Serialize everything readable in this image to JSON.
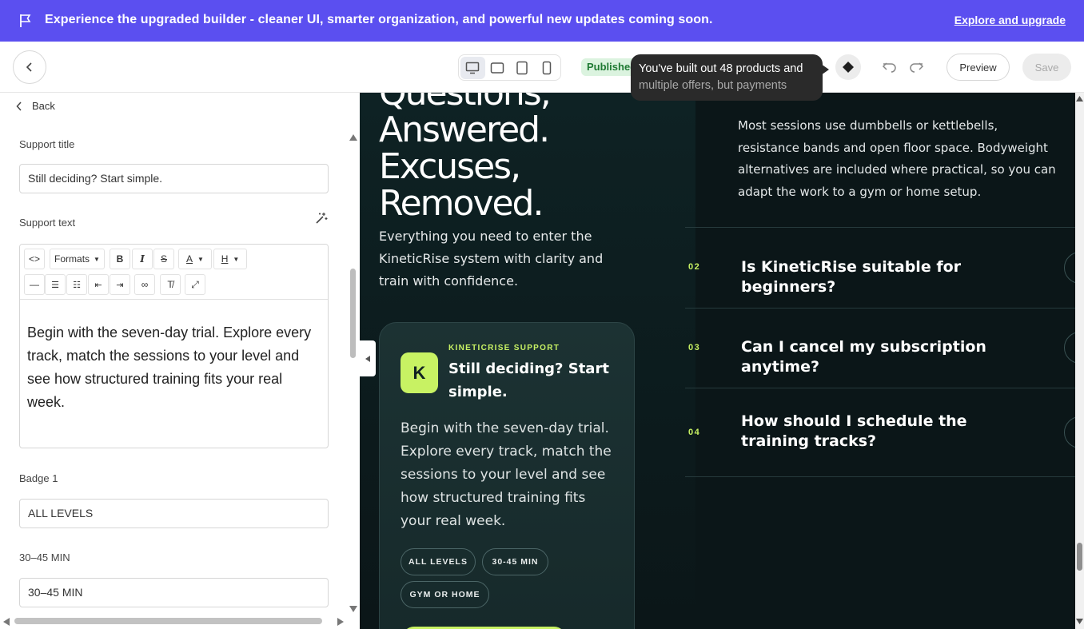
{
  "banner": {
    "message": "Experience the upgraded builder - cleaner UI, smarter organization, and powerful new updates coming soon.",
    "link": "Explore and upgrade"
  },
  "toolbar": {
    "status": "Published",
    "tooltip_line1": "You've built out 48 products and",
    "tooltip_line2": "multiple offers, but payments",
    "preview_label": "Preview",
    "save_label": "Save",
    "devices": [
      "desktop-icon",
      "tablet-landscape-icon",
      "tablet-portrait-icon",
      "mobile-icon"
    ]
  },
  "panel": {
    "back_label": "Back",
    "support_title_label": "Support title",
    "support_title_value": "Still deciding? Start simple.",
    "support_text_label": "Support text",
    "formats_label": "Formats",
    "support_text_value": "Begin with the seven-day trial. Explore every track, match the sessions to your level and see how structured training fits your real week.",
    "badge1_label": "Badge 1",
    "badge1_value": "ALL LEVELS",
    "badge2_label": "30–45 MIN",
    "badge2_value": "30–45 MIN"
  },
  "preview": {
    "hero_line0": "Questions,",
    "hero_line1": "Answered.",
    "hero_line2": "Excuses,",
    "hero_line3": "Removed.",
    "hero_sub": "Everything you need to enter the KineticRise system with clarity and train with confidence.",
    "card": {
      "badge_letter": "K",
      "eyebrow": "KINETICRISE SUPPORT",
      "title": "Still deciding? Start simple.",
      "text": "Begin with the seven-day trial. Explore every track, match the sessions to your level and see how structured training fits your real week.",
      "pills": [
        "ALL LEVELS",
        "30-45 MIN",
        "GYM OR HOME"
      ]
    },
    "faq_intro": "Most sessions use dumbbells or kettlebells, resistance bands and open floor space. Bodyweight alternatives are included where practical, so you can adapt the work to a gym or home setup.",
    "faqs": [
      {
        "num": "02",
        "question": "Is KineticRise suitable for beginners?"
      },
      {
        "num": "03",
        "question": "Can I cancel my subscription anytime?"
      },
      {
        "num": "04",
        "question": "How should I schedule the training tracks?"
      }
    ]
  },
  "colors": {
    "banner": "#5b4ff0",
    "accent_lime": "#c8f263",
    "canvas_bg": "#0b1618",
    "published_bg": "#dbf3df"
  }
}
